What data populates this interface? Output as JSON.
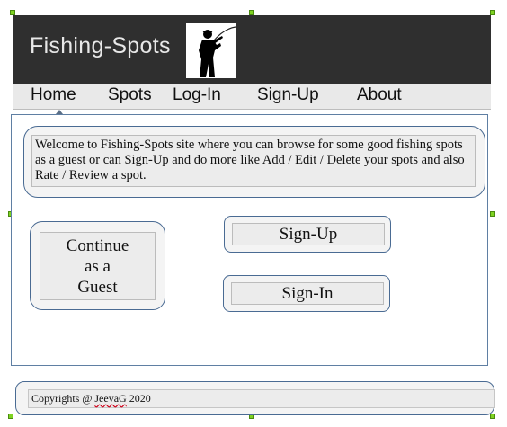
{
  "header": {
    "site_title": "Fishing-Spots",
    "logo_icon": "fisherman-silhouette-icon"
  },
  "nav": {
    "items": [
      {
        "label": "Home"
      },
      {
        "label": "Spots"
      },
      {
        "label": "Log-In"
      },
      {
        "label": "Sign-Up"
      },
      {
        "label": "About"
      }
    ],
    "active": "Home"
  },
  "welcome": {
    "text": "Welcome to Fishing-Spots site where you can browse for some good fishing spots as a guest or can Sign-Up and do more like Add / Edit / Delete your spots and also Rate / Review a spot."
  },
  "buttons": {
    "guest_line1": "Continue",
    "guest_line2": "as a",
    "guest_line3": "Guest",
    "signup": "Sign-Up",
    "signin": "Sign-In"
  },
  "footer": {
    "prefix": "Copyrights @ ",
    "author": "JeevaG",
    "year": " 2020"
  },
  "colors": {
    "header_bg": "#2f2f2f",
    "border_accent": "#4a6b93",
    "handle": "#7ed321"
  }
}
